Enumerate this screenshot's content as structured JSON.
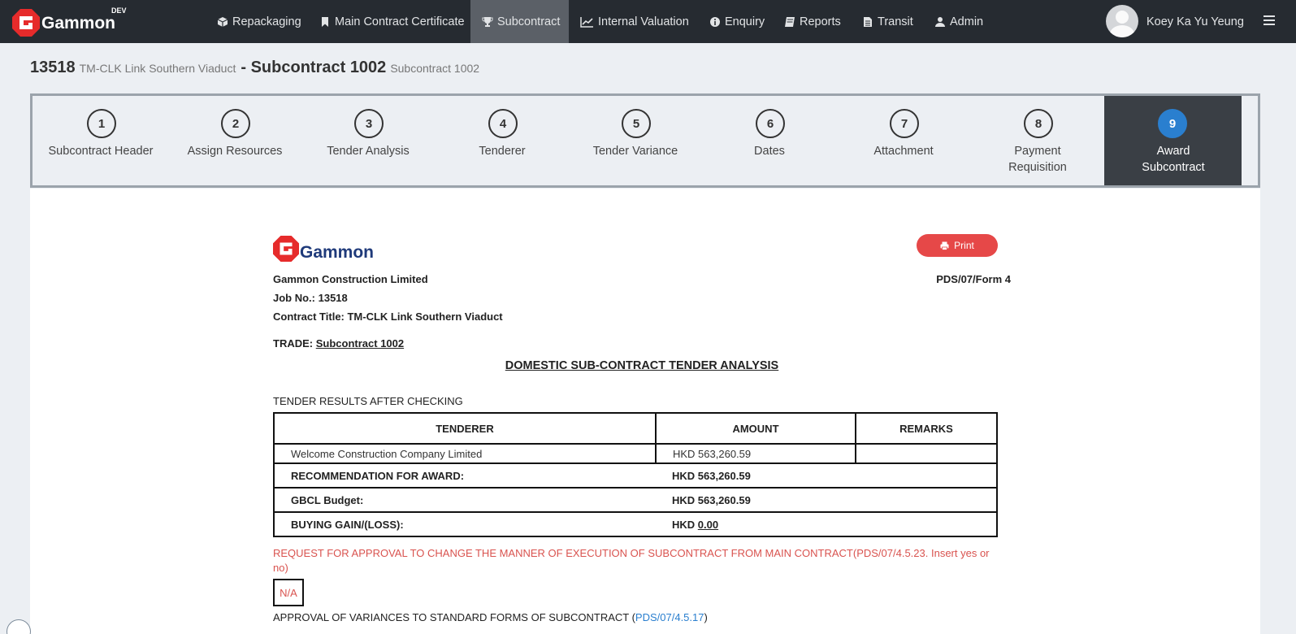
{
  "app": {
    "brand": "Gammon",
    "env": "DEV"
  },
  "nav": {
    "items": [
      {
        "label": "Repackaging",
        "icon": "cube-icon"
      },
      {
        "label": "Main Contract Certificate",
        "icon": "bookmark-icon"
      },
      {
        "label": "Subcontract",
        "icon": "trophy-icon",
        "active": true
      },
      {
        "label": "Internal Valuation",
        "icon": "line-chart-icon"
      },
      {
        "label": "Enquiry",
        "icon": "info-circle-icon"
      },
      {
        "label": "Reports",
        "icon": "book-icon"
      },
      {
        "label": "Transit",
        "icon": "file-icon"
      },
      {
        "label": "Admin",
        "icon": "user-icon"
      }
    ],
    "user": "Koey Ka Yu Yeung"
  },
  "breadcrumb": {
    "job_no": "13518",
    "job_name": "TM-CLK Link Southern Viaduct",
    "subcontract": "- Subcontract 1002",
    "subcontract_desc": "Subcontract 1002"
  },
  "wizard": {
    "steps": [
      {
        "num": "1",
        "label": "Subcontract Header"
      },
      {
        "num": "2",
        "label": "Assign Resources"
      },
      {
        "num": "3",
        "label": "Tender Analysis"
      },
      {
        "num": "4",
        "label": "Tenderer"
      },
      {
        "num": "5",
        "label": "Tender Variance"
      },
      {
        "num": "6",
        "label": "Dates"
      },
      {
        "num": "7",
        "label": "Attachment"
      },
      {
        "num": "8",
        "label": "Payment Requisition"
      },
      {
        "num": "9",
        "label": "Award Subcontract",
        "active": true
      }
    ]
  },
  "doc": {
    "logo_name": "Gammon",
    "print_label": "Print",
    "company": "Gammon Construction Limited",
    "form_id": "PDS/07/Form 4",
    "job_line": "Job No.: 13518",
    "title_line": "Contract Title: TM-CLK Link Southern Viaduct",
    "trade_label": "TRADE:",
    "trade_value": "Subcontract 1002",
    "heading": "DOMESTIC SUB-CONTRACT TENDER ANALYSIS",
    "results_label": "TENDER RESULTS AFTER CHECKING",
    "table": {
      "headers": [
        "TENDERER",
        "AMOUNT",
        "REMARKS"
      ],
      "rows": [
        {
          "tenderer": "Welcome Construction Company Limited",
          "amount": "HKD 563,260.59",
          "remarks": ""
        }
      ],
      "recommendation_label": "RECOMMENDATION FOR AWARD:",
      "recommendation_amount": "HKD 563,260.59",
      "budget_label": "GBCL Budget:",
      "budget_amount": "HKD 563,260.59",
      "gain_label": "BUYING GAIN/(LOSS):",
      "gain_currency": "HKD",
      "gain_value": "0.00"
    },
    "request_text": "REQUEST FOR APPROVAL TO CHANGE THE MANNER OF EXECUTION OF SUBCONTRACT FROM MAIN CONTRACT(PDS/07/4.5.23. Insert yes or no)",
    "request_value": "N/A",
    "approval_text": "APPROVAL OF VARIANCES TO STANDARD FORMS OF SUBCONTRACT (",
    "approval_link": "PDS/07/4.5.17",
    "approval_close": ")"
  },
  "colors": {
    "nav_bg": "#262b31",
    "nav_active": "#5b6067",
    "step_active": "#3a3f45",
    "step_circle_active": "#2a7fcf",
    "brand_red": "#e62b2b",
    "print_btn": "#e64848",
    "warning_text": "#d9534f"
  }
}
